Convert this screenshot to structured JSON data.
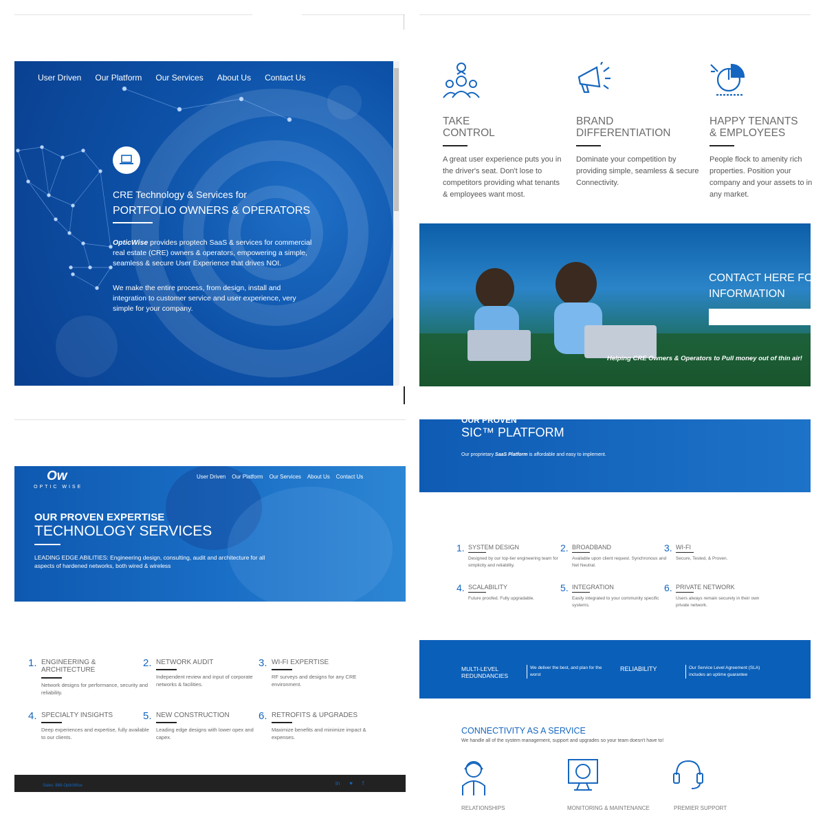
{
  "panel1": {
    "nav": [
      "User Driven",
      "Our Platform",
      "Our Services",
      "About Us",
      "Contact Us"
    ],
    "heading_line1": "CRE Technology & Services for",
    "heading_line2": "PORTFOLIO OWNERS & OPERATORS",
    "brand": "OpticWise",
    "para1": " provides proptech SaaS & services for commercial real estate (CRE) owners & operators, empowering a simple, seamless & secure User Experience that drives NOI.",
    "para2": "We make the entire process, from design, install and integration to customer service and user experience, very simple for your company."
  },
  "panel2": {
    "features": [
      {
        "icon": "users-icon",
        "title1": "TAKE",
        "title2": "CONTROL",
        "text": "A great user experience puts you in the driver's seat. Don't lose to competitors providing what tenants & employees want most."
      },
      {
        "icon": "megaphone-icon",
        "title1": "BRAND",
        "title2": "DIFFERENTIATION",
        "text": "Dominate your competition by providing simple, seamless & secure Connectivity."
      },
      {
        "icon": "pie-chart-icon",
        "title1": "HAPPY TENANTS",
        "title2": "& EMPLOYEES",
        "text": "People flock to amenity rich properties. Position your company and your assets to in any market."
      }
    ],
    "cta_line1": "CONTACT HERE FO",
    "cta_line2": "INFORMATION",
    "caption": "Helping CRE Owners & Operators to Pull money out of thin air!"
  },
  "panel3": {
    "logo": "Ow",
    "logo_sub": "OPTIC WISE",
    "nav": [
      "User Driven",
      "Our Platform",
      "Our Services",
      "About Us",
      "Contact Us"
    ],
    "heading1": "OUR PROVEN EXPERTISE",
    "heading2": "TECHNOLOGY SERVICES",
    "desc": "LEADING EDGE ABILITIES: Engineering design, consulting, audit and architecture for all aspects of hardened networks, both wired & wireless",
    "services": [
      {
        "num": "1.",
        "name": "ENGINEERING & ARCHITECTURE",
        "desc": "Network designs for performance, security and reliability."
      },
      {
        "num": "2.",
        "name": "NETWORK AUDIT",
        "desc": "Independent review and input of corporate networks & facilities."
      },
      {
        "num": "3.",
        "name": "WI-FI EXPERTISE",
        "desc": "RF surveys and designs for any CRE environment."
      },
      {
        "num": "4.",
        "name": "SPECIALTY INSIGHTS",
        "desc": "Deep experiences and expertise, fully available to our clients."
      },
      {
        "num": "5.",
        "name": "NEW CONSTRUCTION",
        "desc": "Leading edge designs with lower opex and capex."
      },
      {
        "num": "6.",
        "name": "RETROFITS & UPGRADES",
        "desc": "Maximize benefits and minimize impact & expenses."
      }
    ],
    "footer_sales": "Sales: 888-OpticWise",
    "footer_social": [
      "in",
      "♥",
      "f"
    ]
  },
  "panel4": {
    "heading_small": "OUR PROVEN",
    "heading": "SIC™ PLATFORM",
    "sub_pre": "Our proprietary ",
    "sub_em": "SaaS Platform",
    "sub_post": " is affordable and easy to implement.",
    "services": [
      {
        "num": "1.",
        "name": "SYSTEM DESIGN",
        "desc": "Designed by our top-tier engineering team for simplicity and reliability."
      },
      {
        "num": "2.",
        "name": "BROADBAND",
        "desc": "Available upon client request. Synchronous and Net Neutral."
      },
      {
        "num": "3.",
        "name": "WI-FI",
        "desc": "Secure, Tested, & Proven."
      },
      {
        "num": "4.",
        "name": "SCALABILITY",
        "desc": "Future proofed. Fully upgradable."
      },
      {
        "num": "5.",
        "name": "INTEGRATION",
        "desc": "Easily integrated to your community specific systems."
      },
      {
        "num": "6.",
        "name": "PRIVATE NETWORK",
        "desc": "Users always remain securely in their own private network."
      }
    ],
    "band": {
      "item1": "MULTI-LEVEL REDUNDANCIES",
      "item1_desc": "We deliver the best, and plan for the worst",
      "item2": "RELIABILITY",
      "item2_desc": "Our Service Level Agreement (SLA) includes an uptime guarantee"
    },
    "caas_title": "CONNECTIVITY AS A SERVICE",
    "caas_desc": "We handle all of the system management, support and upgrades so your team doesn't have to!",
    "caas_items": [
      "RELATIONSHIPS",
      "MONITORING & MAINTENANCE",
      "PREMIER SUPPORT"
    ]
  },
  "colors": {
    "primary_blue": "#0a5fb8",
    "accent_blue": "#1566c0",
    "dark": "#222222"
  }
}
